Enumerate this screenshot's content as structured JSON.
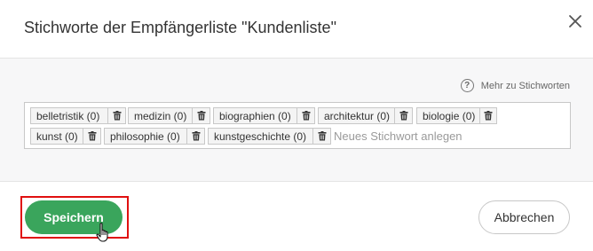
{
  "dialog": {
    "title": "Stichworte der Empfängerliste \"Kundenliste\"",
    "close_icon": "close-icon"
  },
  "help": {
    "icon": "question-circle-icon",
    "label": "Mehr zu Stichworten"
  },
  "tags": [
    {
      "label": "belletristik (0)",
      "delete_icon": "trash-icon"
    },
    {
      "label": "medizin (0)",
      "delete_icon": "trash-icon"
    },
    {
      "label": "biographien (0)",
      "delete_icon": "trash-icon"
    },
    {
      "label": "architektur (0)",
      "delete_icon": "trash-icon"
    },
    {
      "label": "biologie (0)",
      "delete_icon": "trash-icon"
    },
    {
      "label": "kunst (0)",
      "delete_icon": "trash-icon"
    },
    {
      "label": "philosophie (0)",
      "delete_icon": "trash-icon"
    },
    {
      "label": "kunstgeschichte (0)",
      "delete_icon": "trash-icon"
    }
  ],
  "new_tag": {
    "placeholder": "Neues Stichwort anlegen",
    "value": ""
  },
  "footer": {
    "save_label": "Speichern",
    "cancel_label": "Abbrechen"
  },
  "colors": {
    "primary": "#3aa55c",
    "highlight": "#e01010",
    "panel_bg": "#f7f7f8"
  }
}
